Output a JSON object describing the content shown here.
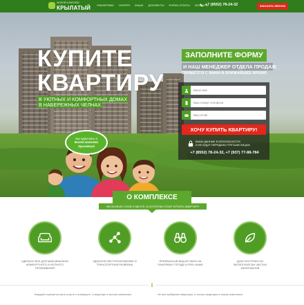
{
  "header": {
    "logo_subtitle": "ЖИЛОЙ КОМПЛЕКС",
    "logo_name": "КРЫЛАТЫЙ",
    "nav": [
      "ПЛАНИРОВКИ",
      "ГАЛЕРЕЯ",
      "АКЦИИ",
      "ДОКУМЕНТЫ",
      "ФОРМЫ ОПЛАТЫ",
      "КОНТАКТЫ"
    ],
    "phone": "+7 (8552) 78-24-32",
    "callback_label": "ЗАКАЗАТЬ ЗВОНОК"
  },
  "hero": {
    "title_line1": "КУПИТЕ",
    "title_line2": "КВАРТИРУ",
    "subtitle_lines": [
      "В УЮТНЫХ И КОМФОРТНЫХ ДОМАХ",
      "В НАБЕРЕЖНЫХ ЧЕЛНАХ"
    ],
    "bubble_line1": "Мы едем жить в",
    "bubble_line2": "Жилой комплекс",
    "bubble_line3": "Крылатый"
  },
  "form": {
    "heading": "ЗАПОЛНИТЕ ФОРМУ",
    "subheading": "И НАШ МЕНЕДЖЕР ОТДЕЛА ПРОДАЖ",
    "subheading2": "СВЯЖЕТСЯ С ВАМИ В БЛИЖАЙШЕЕ ВРЕМЯ",
    "name_placeholder": "Ваше имя",
    "phone_placeholder": "Ваш номер телефона",
    "email_placeholder": "Ваш email",
    "submit_label": "ХОЧУ КУПИТЬ КВАРТИРУ!",
    "secure_line1": "ВАШИ ДАННЫЕ В БЕЗОПАСНОСТИ",
    "secure_line2": "И НЕ БУДУТ ПЕРЕДАНЫ ТРЕТЬИМ ЛИЦАМ",
    "phones": "+7 (8552) 78-24-32, +7 (937) 77-88-784"
  },
  "about": {
    "title": "О КОМПЛЕКСЕ",
    "subtitle": "НЕСКОЛЬКО СЛОВ О МЕСТЕ, В КОТОРОМ СТОИТ КУПИТЬ КВАРТИРУ"
  },
  "features": [
    {
      "icon": "sofa-icon",
      "text": "СДЕЛАНО ВСЕ ДЛЯ МАКСИМАЛЬНО КОМФОРТНОГО И УЮТНОГО ПРОЖИВАНИЯ"
    },
    {
      "icon": "network-icon",
      "text": "УДОБНОЕ МЕСТОПОЛОЖЕНИЕ И ТРАНСПОРТНАЯ РАЗВЯЗКА"
    },
    {
      "icon": "binoculars-icon",
      "text": "ПРЕКРАСНЫЙ ВИД ИЗ ОКОН НА ПАНОРАМУ ГОРОДА И РЕКУ КАМА"
    },
    {
      "icon": "leaf-icon",
      "text": "ДОМ ПОСТРОЕН ИЗ ЭКОЛОГИЧЕСКИ ЧИСТЫХ МАТЕРИАЛОВ"
    }
  ],
  "bottom": {
    "quote_mark": "i",
    "text_left": "Каждый стремится жить в уюте и комфорте, в квартире в жилом комплексе",
    "text_right": "Не все выбирают квартиры, а только квартиры в таком комплексе"
  }
}
